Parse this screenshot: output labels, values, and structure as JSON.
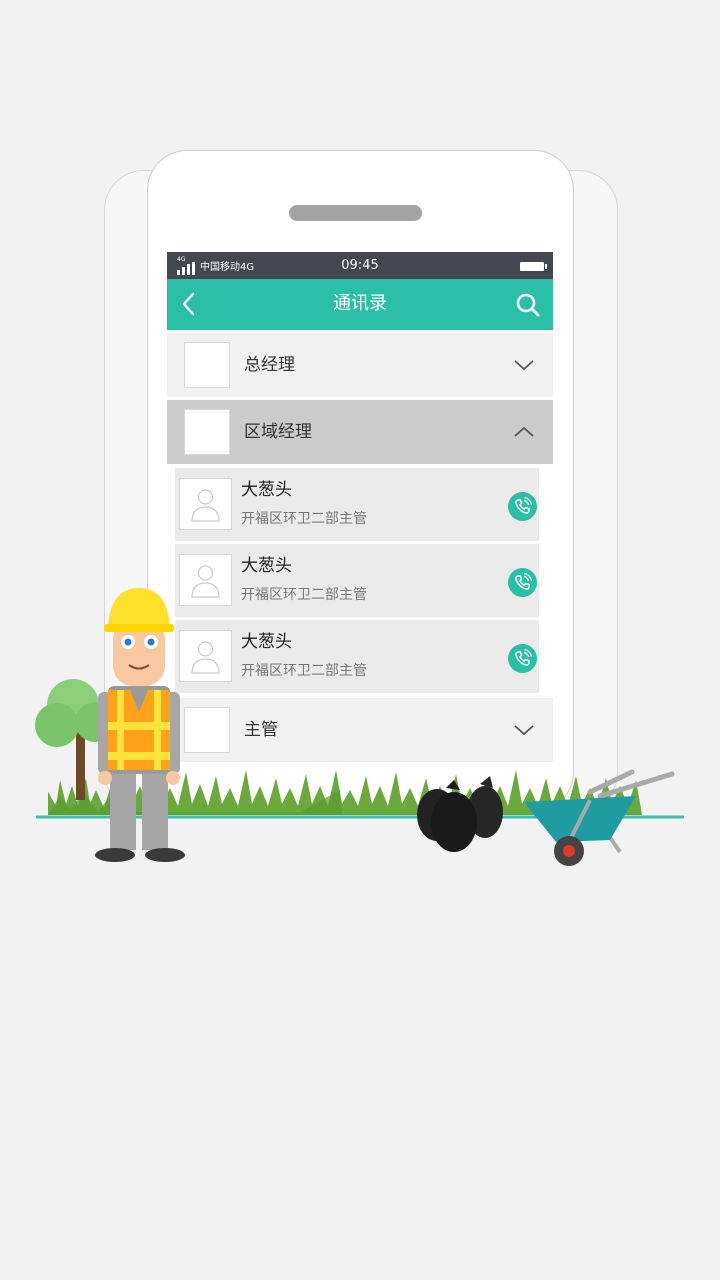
{
  "status_bar": {
    "network_label": "4G",
    "carrier": "中国移动4G",
    "time": "09:45"
  },
  "app_bar": {
    "title": "通讯录",
    "back_icon": "chevron-left-icon",
    "search_icon": "search-icon"
  },
  "groups": [
    {
      "label": "总经理",
      "expanded": false
    },
    {
      "label": "区域经理",
      "expanded": true
    },
    {
      "label": "主管",
      "expanded": false
    }
  ],
  "contacts": [
    {
      "name": "大葱头",
      "role": "开福区环卫二部主管"
    },
    {
      "name": "大葱头",
      "role": "开福区环卫二部主管"
    },
    {
      "name": "大葱头",
      "role": "开福区环卫二部主管"
    }
  ],
  "colors": {
    "accent": "#2bbfa5",
    "status_bar": "#444650",
    "expanded_group_bg": "#cbcbcb",
    "collapsed_group_bg": "#f1f1f1",
    "page_bg": "#f2f2f2"
  }
}
